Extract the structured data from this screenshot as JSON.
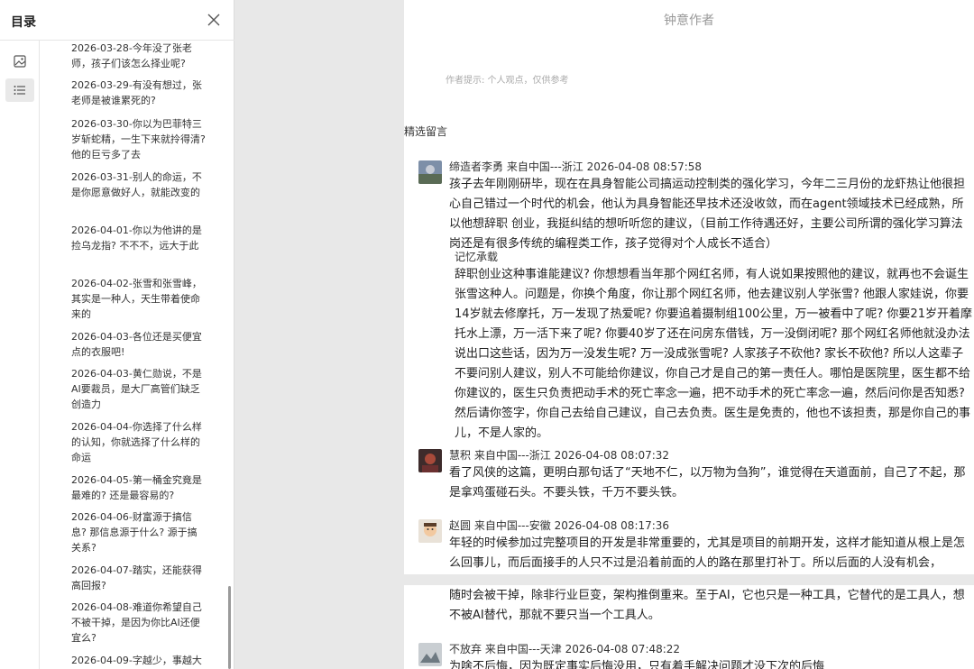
{
  "sidebar": {
    "title": "目录",
    "toc": [
      {
        "text": "2026-03-28-今年没了张老师，孩子们该怎么择业呢?"
      },
      {
        "text": "2026-03-29-有没有想过，张老师是被谁累死的?"
      },
      {
        "text": "2026-03-30-你以为巴菲特三岁斩蛇精，一生下来就拎得清? 他的巨亏多了去"
      },
      {
        "text": "2026-03-31-别人的命运，不是你愿意做好人，就能改变的"
      },
      {
        "text": "2026-04-01-你以为他讲的是捡乌龙指? 不不不，远大于此"
      },
      {
        "text": "2026-04-02-张雪和张雪峰，其实是一种人，天生带着使命来的"
      },
      {
        "text": "2026-04-03-各位还是买便宜点的衣服吧!"
      },
      {
        "text": "2026-04-03-黄仁勋说，不是AI要裁员，是大厂高管们缺乏创造力"
      },
      {
        "text": "2026-04-04-你选择了什么样的认知，你就选择了什么样的命运"
      },
      {
        "text": "2026-04-05-第一桶金究竟是最难的? 还是最容易的?"
      },
      {
        "text": "2026-04-06-财富源于搞信息? 那信息源于什么? 源于搞关系?"
      },
      {
        "text": "2026-04-07-踏实，还能获得高回报?"
      },
      {
        "text": "2026-04-08-难道你希望自己不被干掉，是因为你比AI还便宜么?"
      },
      {
        "text": "2026-04-09-字越少，事越大"
      }
    ]
  },
  "article": {
    "author_title": "钟意作者",
    "author_note": "作者提示: 个人观点，仅供参考",
    "section_title": "精选留言",
    "comments": [
      {
        "meta": "缔造者李勇  来自中国---浙江 2026-04-08 08:57:58",
        "body": "孩子去年刚刚研毕，现在在具身智能公司搞运动控制类的强化学习，今年二三月份的龙虾热让他很担心自己错过一个时代的机会，他认为具身智能还早技术还没收敛，而在agent领域技术已经成熟，所以他想辞职 创业，我挺纠结的想听听您的建议，（目前工作待遇还好，主要公司所谓的强化学习算法岗还是有很多传统的编程类工作，孩子觉得对个人成长不适合）",
        "reply_label": "记忆承载",
        "reply": "辞职创业这种事谁能建议? 你想想看当年那个网红名师，有人说如果按照他的建议，就再也不会诞生张雪这种人。问题是，你换个角度，你让那个网红名师，他去建议别人学张雪? 他跟人家娃说，你要14岁就去修摩托，万一发现了热爱呢? 你要追着摄制组100公里，万一被看中了呢? 你要21岁开着摩托水上漂，万一活下来了呢? 你要40岁了还在问房东借钱，万一没倒闭呢? 那个网红名师他就没办法说出口这些话，因为万一没发生呢? 万一没成张雪呢? 人家孩子不砍他? 家长不砍他? 所以人这辈子不要问别人建议，别人不可能给你建议，你自己才是自己的第一责任人。哪怕是医院里，医生都不给你建议的，医生只负责把动手术的死亡率念一遍，把不动手术的死亡率念一遍，然后问你是否知悉? 然后请你签字，你自己去给自己建议，自己去负责。医生是免责的，他也不该担责，那是你自己的事儿，不是人家的。"
      },
      {
        "meta": "慧积  来自中国---浙江 2026-04-08 08:07:32",
        "body": "看了风侠的这篇，更明白那句话了“天地不仁，以万物为刍狗”，谁觉得在天道面前，自己了不起，那是拿鸡蛋碰石头。不要头铁，千万不要头铁。"
      },
      {
        "meta": "赵圆  来自中国---安徽 2026-04-08 08:17:36",
        "body": "年轻的时候参加过完整项目的开发是非常重要的，尤其是项目的前期开发，这样才能知道从根上是怎么回事儿，而后面接手的人只不过是沿着前面的人的路在那里打补丁。所以后面的人没有机会，",
        "body_cont": "随时会被干掉，除非行业巨变，架构推倒重来。至于AI，它也只是一种工具，它替代的是工具人，想不被AI替代，那就不要只当一个工具人。"
      },
      {
        "meta": "不放弃  来自中国---天津 2026-04-08 07:48:22",
        "body": "为啥不后悔，因为既定事实后悔没用，只有着手解决问题才没下次的后悔"
      }
    ]
  },
  "colors": {
    "page_bg": "#e8e8e8",
    "panel_bg": "#ffffff",
    "muted": "#999999"
  }
}
